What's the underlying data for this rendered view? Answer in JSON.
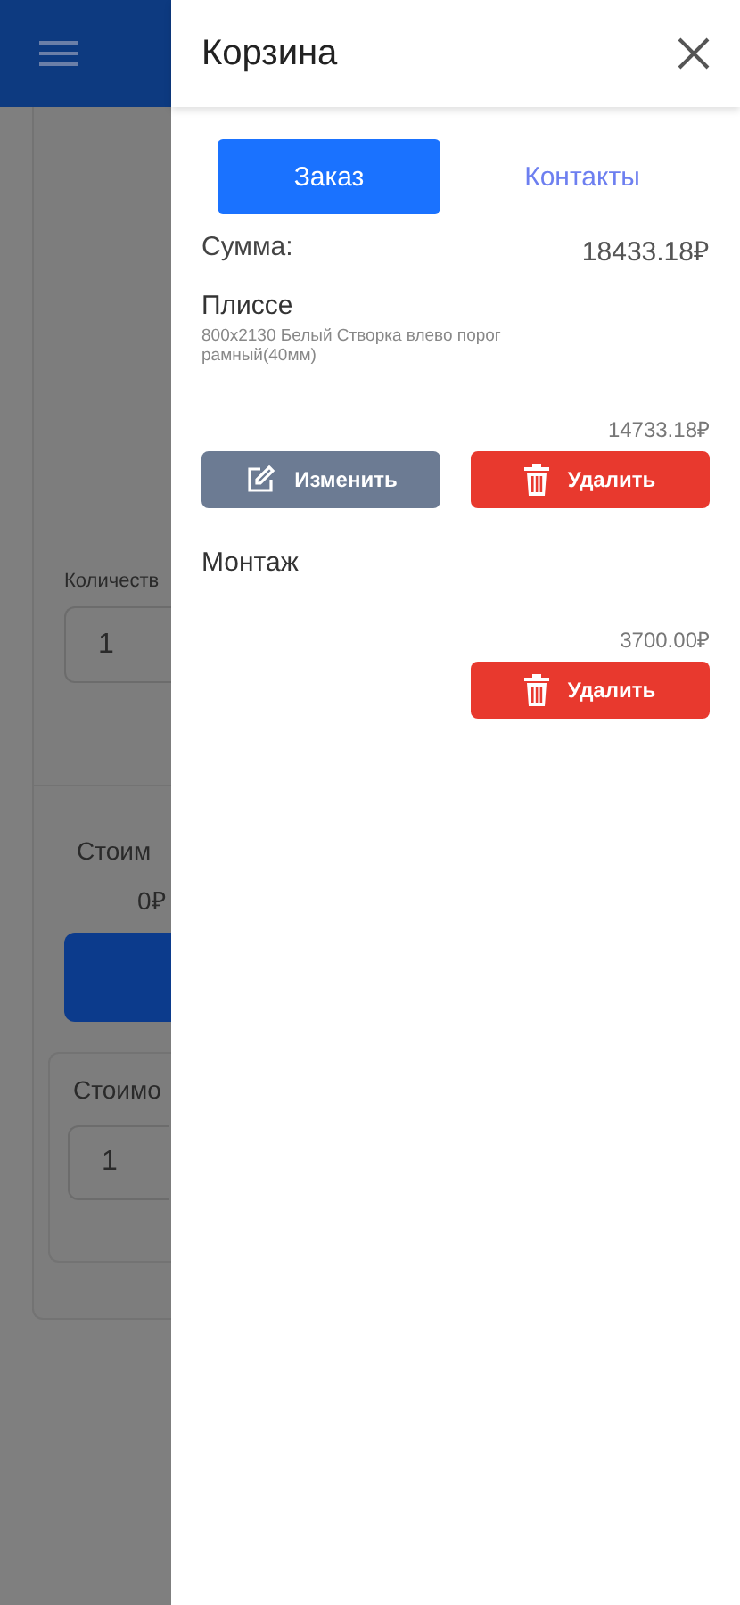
{
  "background": {
    "quantity_label": "Количеств",
    "quantity_value": "1",
    "cost_label": "Стоим",
    "cost_value": "0₽",
    "cost_label_2": "Стоимо",
    "quantity_value_2": "1"
  },
  "cart": {
    "title": "Корзина",
    "tabs": [
      {
        "label": "Заказ",
        "selected": true
      },
      {
        "label": "Контакты",
        "selected": false
      }
    ],
    "total_label": "Сумма:",
    "total_value": "18433.18₽",
    "items": [
      {
        "name": "Плиссе",
        "description": "800х2130 Белый Створка влево порог рамный(40мм)",
        "price": "14733.18₽",
        "buttons": [
          {
            "kind": "edit",
            "label": "Изменить"
          },
          {
            "kind": "delete",
            "label": "Удалить"
          }
        ]
      },
      {
        "name": "Монтаж",
        "price": "3700.00₽",
        "buttons": [
          {
            "kind": "delete",
            "label": "Удалить"
          }
        ]
      }
    ]
  }
}
